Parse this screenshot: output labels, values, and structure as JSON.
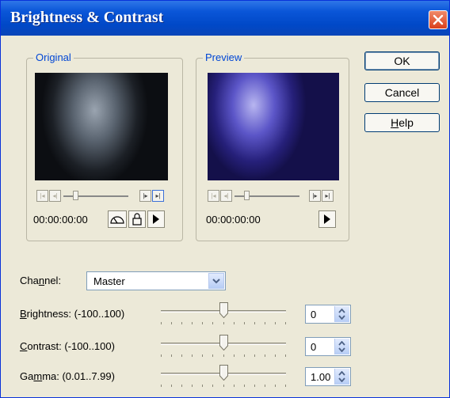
{
  "window": {
    "title": "Brightness & Contrast"
  },
  "groups": {
    "original": "Original",
    "preview": "Preview"
  },
  "original": {
    "timecode": "00:00:00:00"
  },
  "preview": {
    "timecode": "00:00:00:00"
  },
  "buttons": {
    "ok": "OK",
    "cancel": "Cancel",
    "help": "Help"
  },
  "channel": {
    "label": "Channel:",
    "value": "Master"
  },
  "sliders": [
    {
      "label": "Brightness: (-100..100)",
      "value": "0",
      "level": 0.5
    },
    {
      "label": "Contrast: (-100..100)",
      "value": "0",
      "level": 0.5
    },
    {
      "label": "Gamma: (0.01..7.99)",
      "value": "1.00",
      "level": 0.5
    }
  ],
  "colors": {
    "titlebar": "#0a56d8",
    "close": "#d9401c",
    "preview_tint": "#5c56c8",
    "dialog": "#ece9d8"
  },
  "icons": [
    "close-icon",
    "rewind-icon",
    "prev-frame-icon",
    "next-frame-icon",
    "end-icon",
    "gauge-icon",
    "lock-icon",
    "play-icon",
    "dropdown-arrow-icon",
    "spin-up-icon",
    "spin-down-icon"
  ]
}
